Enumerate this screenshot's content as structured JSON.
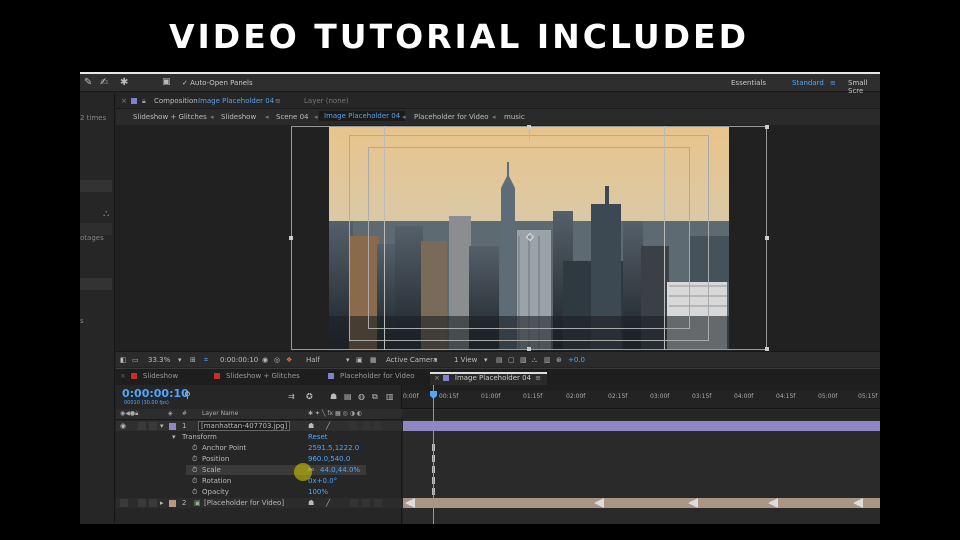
{
  "banner": {
    "text": "VIDEO TUTORIAL INCLUDED"
  },
  "toolbar": {
    "auto_open": "Auto-Open Panels",
    "workspace_essentials": "Essentials",
    "workspace_standard": "Standard",
    "workspace_small": "Small Scre"
  },
  "left_panel": {
    "text_times": "2 times",
    "text_otages": "otages",
    "text_s": "s"
  },
  "comp_panel": {
    "composition_prefix": "Composition",
    "composition_name": "Image Placeholder 04",
    "layer_panel": "Layer (none)"
  },
  "breadcrumbs": [
    "Slideshow + Glitches",
    "Slideshow",
    "Scene 04",
    "Image Placeholder 04",
    "Placeholder for Video",
    "music"
  ],
  "viewer_controls": {
    "zoom": "33.3%",
    "timecode": "0:00:00:10",
    "resolution": "Half",
    "camera": "Active Camera",
    "views": "1 View",
    "exposure": "+0.0"
  },
  "timeline_tabs": [
    {
      "label": "Slideshow",
      "color": "#c03030"
    },
    {
      "label": "Slideshow + Glitches",
      "color": "#c03030"
    },
    {
      "label": "Placeholder for Video",
      "color": "#8080d0"
    },
    {
      "label": "Image Placeholder 04",
      "color": "#8080d0"
    }
  ],
  "timeline": {
    "timecode": "0:00:00:10",
    "fps": "00010 (30.00 fps)",
    "layer_name_header": "Layer Name",
    "ruler": [
      "0:00f",
      "00:15f",
      "01:00f",
      "01:15f",
      "02:00f",
      "02:15f",
      "03:00f",
      "03:15f",
      "04:00f",
      "04:15f",
      "05:00f",
      "05:15f"
    ],
    "layers": [
      {
        "num": "1",
        "name": "[manhattan-407703.jpg]",
        "color": "#8f86c6"
      },
      {
        "num": "2",
        "name": "[Placeholder for Video]",
        "color": "#b89a7a"
      }
    ],
    "transform_label": "Transform",
    "reset_label": "Reset",
    "properties": [
      {
        "name": "Anchor Point",
        "value": "2591.5,1222.0"
      },
      {
        "name": "Position",
        "value": "960.0,540.0"
      },
      {
        "name": "Scale",
        "value": "44.0,44.0%"
      },
      {
        "name": "Rotation",
        "value": "0x+0.0°"
      },
      {
        "name": "Opacity",
        "value": "100%"
      }
    ]
  },
  "colors": {
    "accent": "#4ea6ff",
    "panel": "#232323"
  }
}
